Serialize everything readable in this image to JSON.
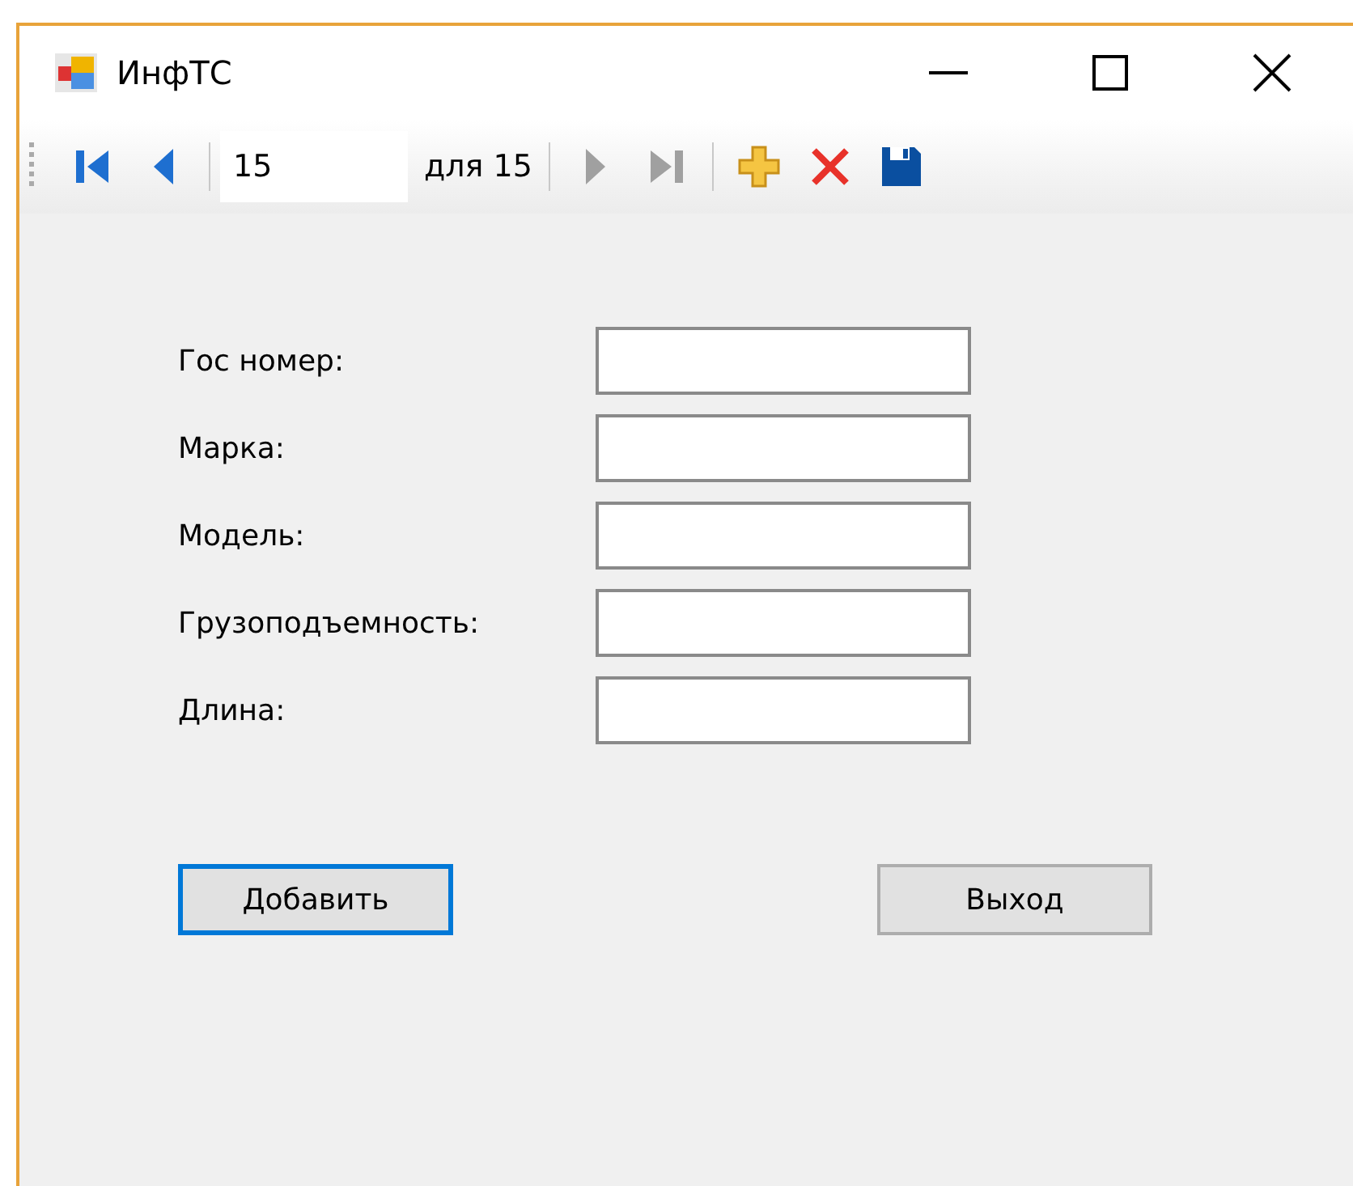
{
  "window": {
    "title": "ИнфТС"
  },
  "toolbar": {
    "items": [
      {
        "kind": "first",
        "disabled": false
      },
      {
        "kind": "prev",
        "disabled": false
      },
      {
        "kind": "separator"
      },
      {
        "kind": "position",
        "value": "15"
      },
      {
        "kind": "count",
        "text": "для 15"
      },
      {
        "kind": "separator"
      },
      {
        "kind": "next",
        "disabled": true
      },
      {
        "kind": "last",
        "disabled": true
      },
      {
        "kind": "separator"
      },
      {
        "kind": "add",
        "disabled": false
      },
      {
        "kind": "delete",
        "disabled": false
      },
      {
        "kind": "save",
        "disabled": false
      }
    ]
  },
  "fields": [
    {
      "label": "Гос номер:"
    },
    {
      "label": "Марка:"
    },
    {
      "label": "Модель:"
    },
    {
      "label": "Грузоподъемность:"
    },
    {
      "label": "Длина:"
    }
  ],
  "buttons": [
    {
      "label": "Добавить",
      "focused": true
    },
    {
      "label": "Выход",
      "focused": false
    }
  ]
}
